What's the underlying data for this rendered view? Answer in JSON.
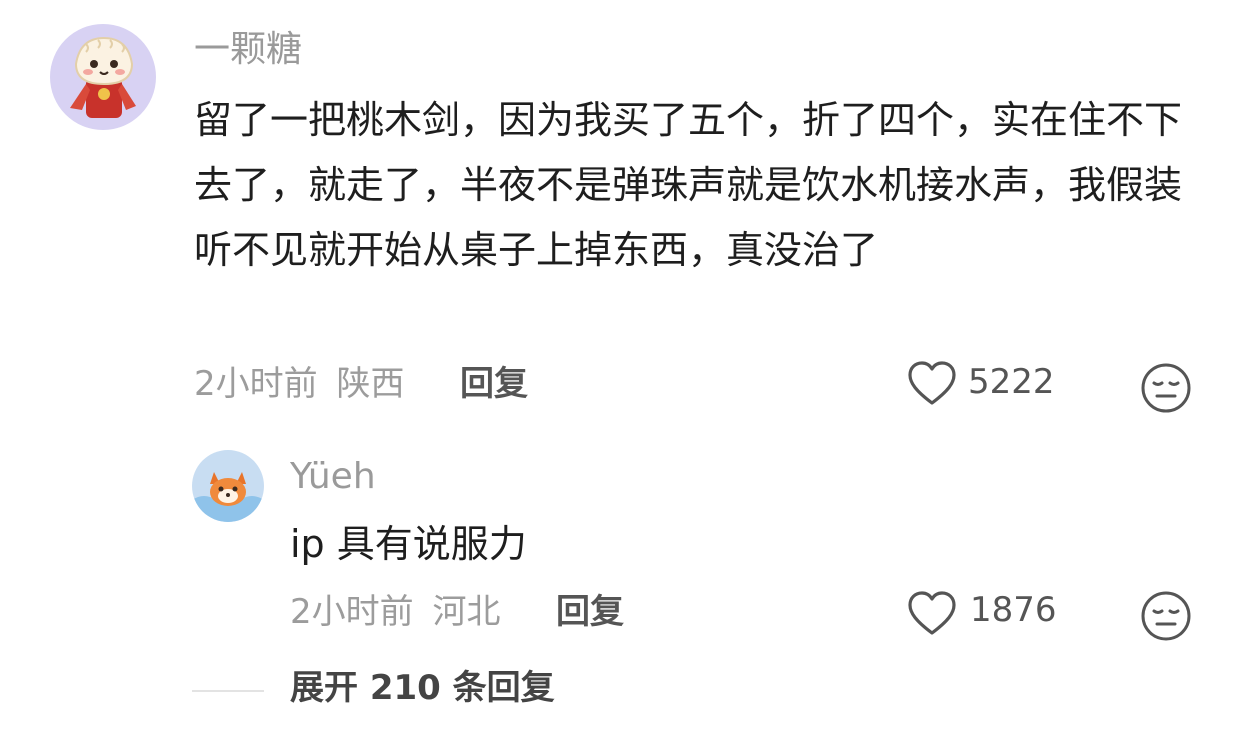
{
  "comment": {
    "username": "一颗糖",
    "text": "留了一把桃木剑，因为我买了五个，折了四个，实在住不下去了，就走了，半夜不是弹珠声就是饮水机接水声，我假装听不见就开始从桌子上掉东西，真没治了",
    "time": "2小时前",
    "location": "陕西",
    "reply_label": "回复",
    "likes": "5222",
    "avatar_icon": "dumpling-mascot-icon",
    "like_icon": "heart-outline-icon",
    "dislike_icon": "neutral-face-icon"
  },
  "reply": {
    "username": "Yüeh",
    "text": "ip 具有说服力",
    "time": "2小时前",
    "location": "河北",
    "reply_label": "回复",
    "likes": "1876",
    "avatar_icon": "fox-mascot-icon",
    "like_icon": "heart-outline-icon",
    "dislike_icon": "neutral-face-icon"
  },
  "expand_label": "展开 210 条回复",
  "colors": {
    "avatar_bg": "#d8d2f3",
    "reply_avatar_bg": "#c8ddf2",
    "icon_gray": "#555555"
  }
}
